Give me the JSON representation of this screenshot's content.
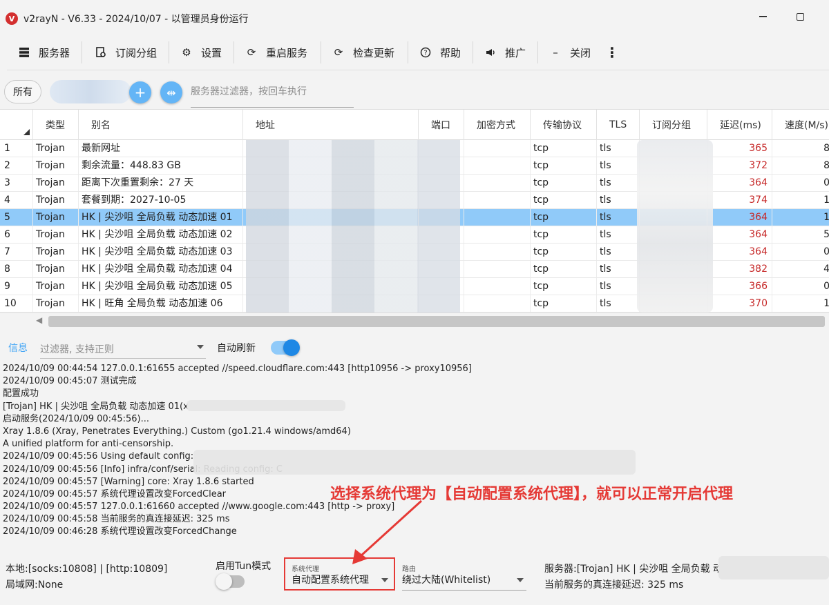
{
  "window": {
    "title": "v2rayN - V6.33 - 2024/10/07 - 以管理员身份运行",
    "logo": "V"
  },
  "toolbar": [
    {
      "label": "服务器",
      "icon": "server-icon"
    },
    {
      "label": "订阅分组",
      "icon": "subscription-icon"
    },
    {
      "label": "设置",
      "icon": "gear-icon"
    },
    {
      "label": "重启服务",
      "icon": "restart-icon"
    },
    {
      "label": "检查更新",
      "icon": "update-icon"
    },
    {
      "label": "帮助",
      "icon": "help-icon"
    },
    {
      "label": "推广",
      "icon": "megaphone-icon"
    },
    {
      "label": "关闭",
      "icon": "minus-icon"
    }
  ],
  "filter": {
    "all_label": "所有",
    "placeholder": "服务器过滤器，按回车执行"
  },
  "table": {
    "headers": [
      "类型",
      "别名",
      "地址",
      "端口",
      "加密方式",
      "传输协议",
      "TLS",
      "订阅分组",
      "延迟(ms)",
      "速度(M/s)"
    ],
    "rows": [
      {
        "idx": "1",
        "type": "Trojan",
        "alias": "最新网址",
        "trans": "tcp",
        "tls": "tls",
        "delay": "365",
        "speed": "8"
      },
      {
        "idx": "2",
        "type": "Trojan",
        "alias": "剩余流量：448.83 GB",
        "trans": "tcp",
        "tls": "tls",
        "delay": "372",
        "speed": "8"
      },
      {
        "idx": "3",
        "type": "Trojan",
        "alias": "距离下次重置剩余：27 天",
        "trans": "tcp",
        "tls": "tls",
        "delay": "364",
        "speed": "0"
      },
      {
        "idx": "4",
        "type": "Trojan",
        "alias": "套餐到期：2027-10-05",
        "trans": "tcp",
        "tls": "tls",
        "delay": "374",
        "speed": "1"
      },
      {
        "idx": "5",
        "type": "Trojan",
        "alias": "HK | 尖沙咀 全局负载 动态加速 01",
        "trans": "tcp",
        "tls": "tls",
        "delay": "364",
        "speed": "1",
        "selected": true
      },
      {
        "idx": "6",
        "type": "Trojan",
        "alias": "HK | 尖沙咀 全局负载 动态加速 02",
        "trans": "tcp",
        "tls": "tls",
        "delay": "364",
        "speed": "5"
      },
      {
        "idx": "7",
        "type": "Trojan",
        "alias": "HK | 尖沙咀 全局负载 动态加速 03",
        "trans": "tcp",
        "tls": "tls",
        "delay": "364",
        "speed": "0"
      },
      {
        "idx": "8",
        "type": "Trojan",
        "alias": "HK | 尖沙咀 全局负载 动态加速 04",
        "trans": "tcp",
        "tls": "tls",
        "delay": "382",
        "speed": "4"
      },
      {
        "idx": "9",
        "type": "Trojan",
        "alias": "HK | 尖沙咀 全局负载 动态加速 05",
        "trans": "tcp",
        "tls": "tls",
        "delay": "366",
        "speed": "0"
      },
      {
        "idx": "10",
        "type": "Trojan",
        "alias": "HK | 旺角 全局负载 动态加速 06",
        "trans": "tcp",
        "tls": "tls",
        "delay": "370",
        "speed": "1"
      }
    ]
  },
  "log": {
    "tab": "信息",
    "filter_placeholder": "过滤器, 支持正则",
    "auto_refresh": "自动刷新",
    "lines": [
      "2024/10/09 00:44:54 127.0.0.1:61655 accepted //speed.cloudflare.com:443 [http10956 -> proxy10956]",
      "2024/10/09 00:45:07 测试完成",
      "配置成功",
      "[Trojan] HK | 尖沙咀 全局负载 动态加速 01(x",
      "启动服务(2024/10/09 00:45:56)...",
      "Xray 1.8.6 (Xray, Penetrates Everything.) Custom (go1.21.4 windows/amd64)",
      "A unified platform for anti-censorship.",
      "2024/10/09 00:45:56 Using default config:",
      "2024/10/09 00:45:56 [Info] infra/conf/serial: Reading config: C",
      "2024/10/09 00:45:57 [Warning] core: Xray 1.8.6 started",
      "2024/10/09 00:45:57 系统代理设置改变ForcedClear",
      "2024/10/09 00:45:57 127.0.0.1:61660 accepted //www.google.com:443 [http -> proxy]",
      "2024/10/09 00:45:58 当前服务的真连接延迟: 325 ms",
      "2024/10/09 00:46:28 系统代理设置改变ForcedChange"
    ]
  },
  "annotation": "选择系统代理为【自动配置系统代理】，就可以正常开启代理",
  "status": {
    "local": "本地:[socks:10808] | [http:10809]",
    "lan": "局域网:None",
    "tun_label": "启用Tun模式",
    "sys_proxy_label": "系统代理",
    "sys_proxy_value": "自动配置系统代理",
    "route_label": "路由",
    "route_value": "绕过大陆(Whitelist)",
    "server": "服务器:[Trojan] HK | 尖沙咀 全局负载 动",
    "delay": "当前服务的真连接延迟: 325 ms"
  },
  "colors": {
    "accent": "#42a5f5",
    "selected_row": "#90caf9",
    "delay_text": "#c62828",
    "annotation": "#e53935"
  }
}
